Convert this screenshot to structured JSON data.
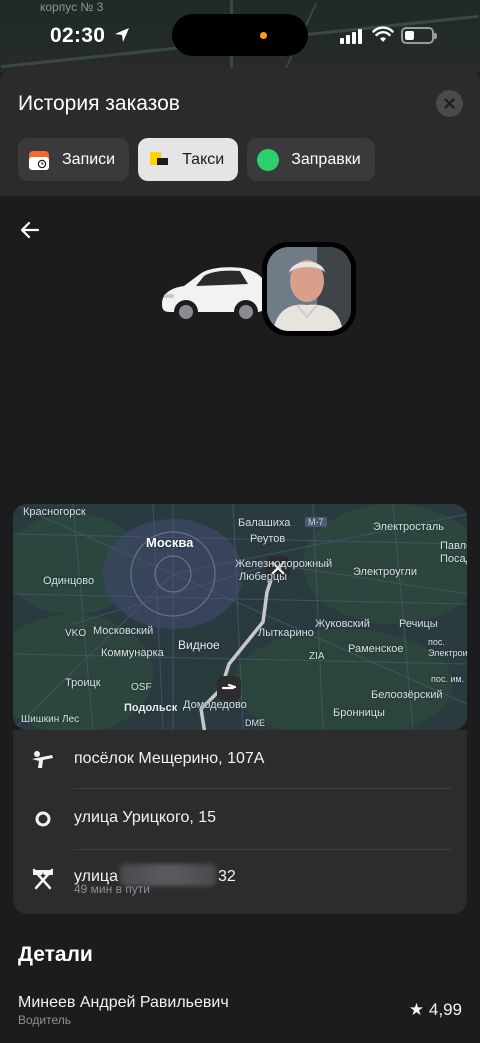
{
  "status_bar": {
    "time": "02:30"
  },
  "top_map": {
    "label_left": "корпус № 3"
  },
  "sheet": {
    "title": "История заказов",
    "tabs": [
      {
        "label": "Записи",
        "icon": "calendar-icon"
      },
      {
        "label": "Такси",
        "icon": "taxi-icon",
        "active": true
      },
      {
        "label": "Заправки",
        "icon": "fuel-icon"
      }
    ]
  },
  "map": {
    "labels": {
      "krasnogorsk": "Красногорск",
      "balashikha": "Балашиха",
      "m7": "M-7",
      "elektrostal": "Электросталь",
      "moskva": "Москва",
      "reutov": "Реутов",
      "pavlo": "Павло",
      "posad": "Посад",
      "odintsovo": "Одинцово",
      "zheleznodorozhny": "Железнодорожный",
      "lyubertsy": "Люберцы",
      "elektrougli": "Электроугли",
      "vko": "VKO",
      "moskovsky": "Московский",
      "vidnoe": "Видное",
      "lytkarino": "Лыткарино",
      "zhukovsky": "Жуковский",
      "rechitsy": "Речицы",
      "kommunarka": "Коммунарка",
      "zia": "ZIA",
      "ramenskoe": "Раменское",
      "pos": "пос.",
      "elektroi": "Электрои",
      "troitsk": "Троицк",
      "osf": "OSF",
      "domodedovo": "Домодедово",
      "beloozersky": "Белоозёрский",
      "posim": "пос. им.",
      "podolsk": "Подольск",
      "shishkin_les": "Шишкин Лес",
      "bronnitsy": "Бронницы",
      "dme": "DME"
    }
  },
  "route": {
    "pickup": "посёлок Мещерино, 107А",
    "stop": "улица Урицкого, 15",
    "destination_prefix": "улица",
    "destination_suffix": "32",
    "duration": "49 мин в пути"
  },
  "details": {
    "title": "Детали",
    "driver_name": "Минеев Андрей Равильевич",
    "driver_role": "Водитель",
    "rating": "4,99"
  },
  "colors": {
    "background": "#1c1c1e",
    "sheet": "#2b2b2d",
    "card": "#2c2c2e",
    "taxi_yellow": "#fcd200",
    "fuel_green": "#2ed06e",
    "calendar_orange": "#f26a2e"
  }
}
